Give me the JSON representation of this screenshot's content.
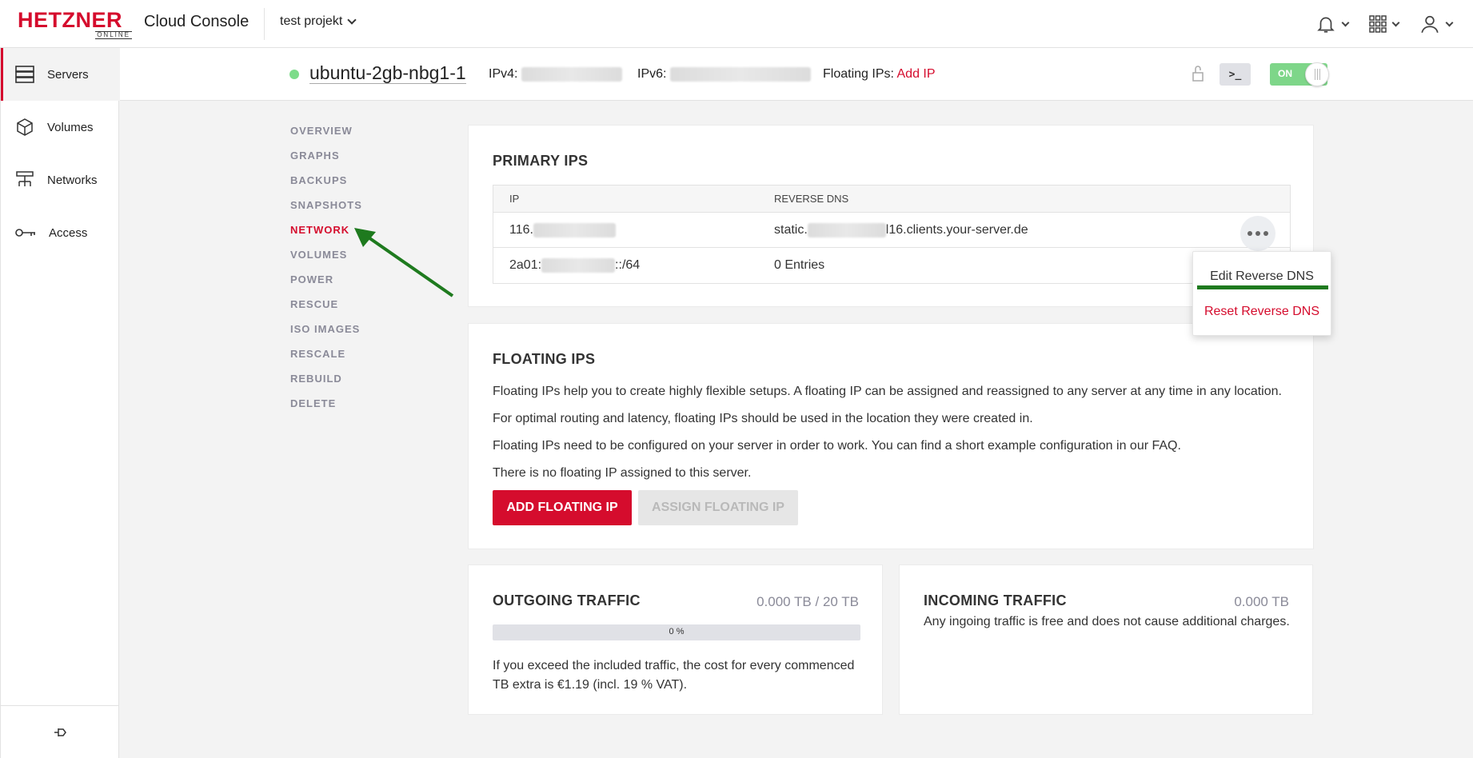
{
  "brand": {
    "name": "HETZNER",
    "sub": "ONLINE",
    "app_title": "Cloud Console"
  },
  "project": {
    "name": "test projekt"
  },
  "topbar_icons": [
    "bell-icon",
    "apps-grid-icon",
    "user-icon"
  ],
  "rail": {
    "items": [
      {
        "label": "Servers",
        "icon": "servers-icon",
        "active": true
      },
      {
        "label": "Volumes",
        "icon": "cube-icon",
        "active": false
      },
      {
        "label": "Networks",
        "icon": "network-icon",
        "active": false
      },
      {
        "label": "Access",
        "icon": "key-icon",
        "active": false
      }
    ],
    "footer_icon": "pin-icon"
  },
  "server": {
    "name": "ubuntu-2gb-nbg1-1",
    "status_color": "#7ddc8a",
    "ipv4_label": "IPv4:",
    "ipv6_label": "IPv6:",
    "floating_label": "Floating IPs:",
    "add_ip": "Add IP",
    "power": "ON"
  },
  "subnav": [
    {
      "label": "OVERVIEW",
      "active": false
    },
    {
      "label": "GRAPHS",
      "active": false
    },
    {
      "label": "BACKUPS",
      "active": false
    },
    {
      "label": "SNAPSHOTS",
      "active": false
    },
    {
      "label": "NETWORK",
      "active": true
    },
    {
      "label": "VOLUMES",
      "active": false
    },
    {
      "label": "POWER",
      "active": false
    },
    {
      "label": "RESCUE",
      "active": false
    },
    {
      "label": "ISO IMAGES",
      "active": false
    },
    {
      "label": "RESCALE",
      "active": false
    },
    {
      "label": "REBUILD",
      "active": false
    },
    {
      "label": "DELETE",
      "active": false
    }
  ],
  "primary_ips": {
    "title": "PRIMARY IPS",
    "col_ip": "IP",
    "col_rdns": "REVERSE DNS",
    "rows": [
      {
        "ip_prefix": "116.",
        "ip_suffix": "",
        "rdns_prefix": "static.",
        "rdns_suffix": "l16.clients.your-server.de"
      },
      {
        "ip_prefix": "2a01:",
        "ip_suffix": "::/64",
        "rdns_prefix": "0 Entries",
        "rdns_suffix": ""
      }
    ]
  },
  "menu": {
    "edit": "Edit Reverse DNS",
    "reset": "Reset Reverse DNS"
  },
  "floating_ips": {
    "title": "FLOATING IPS",
    "p1": "Floating IPs help you to create highly flexible setups. A floating IP can be assigned and reassigned to any server at any time in any location.",
    "p2": "For optimal routing and latency, floating IPs should be used in the location they were created in.",
    "p3": "Floating IPs need to be configured on your server in order to work. You can find a short example configuration in our FAQ.",
    "p4": "There is no floating IP assigned to this server.",
    "add_btn": "ADD FLOATING IP",
    "assign_btn": "ASSIGN FLOATING IP"
  },
  "outgoing": {
    "title": "OUTGOING TRAFFIC",
    "value": "0.000 TB / 20 TB",
    "progress_label": "0 %",
    "progress_fraction": 0,
    "note": "If you exceed the included traffic, the cost for every commenced TB extra is €1.19 (incl. 19 % VAT)."
  },
  "incoming": {
    "title": "INCOMING TRAFFIC",
    "value": "0.000 TB",
    "note": "Any ingoing traffic is free and does not cause additional charges."
  },
  "colors": {
    "brand_red": "#d50c2d",
    "annotation_green": "#1e7a1e"
  }
}
